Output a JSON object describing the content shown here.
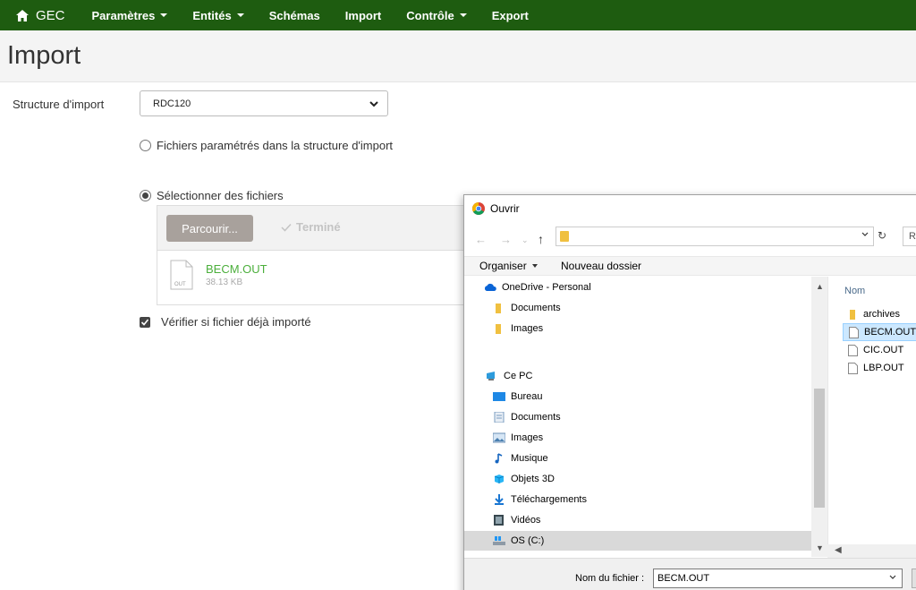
{
  "navbar": {
    "brand": "GEC",
    "items": [
      {
        "label": "Paramètres",
        "dropdown": true
      },
      {
        "label": "Entités",
        "dropdown": true
      },
      {
        "label": "Schémas",
        "dropdown": false
      },
      {
        "label": "Import",
        "dropdown": false
      },
      {
        "label": "Contrôle",
        "dropdown": true
      },
      {
        "label": "Export",
        "dropdown": false
      }
    ],
    "bg_color": "#1e5c10"
  },
  "page": {
    "title": "Import"
  },
  "form": {
    "structure_label": "Structure d'import",
    "structure_value": "RDC120",
    "radio_param": "Fichiers paramétrés dans la structure d'import",
    "radio_select": "Sélectionner des fichiers",
    "browse_label": "Parcourir...",
    "done_label": "Terminé",
    "file": {
      "name": "BECM.OUT",
      "size": "38.13 KB",
      "icon_text": "OUT"
    },
    "check_label": "Vérifier si fichier déjà importé"
  },
  "dialog": {
    "title": "Ouvrir",
    "toolbar": {
      "organise": "Organiser",
      "new_folder": "Nouveau dossier"
    },
    "search_placeholder": "R",
    "nav_items": [
      {
        "label": "OneDrive - Personal",
        "icon": "cloud-icon",
        "indent": 1
      },
      {
        "label": "Documents",
        "icon": "folder-icon",
        "indent": 2
      },
      {
        "label": "Images",
        "icon": "folder-icon",
        "indent": 2
      },
      {
        "label": "Ce PC",
        "icon": "computer-icon",
        "indent": 1
      },
      {
        "label": "Bureau",
        "icon": "desktop-icon",
        "indent": 2
      },
      {
        "label": "Documents",
        "icon": "documents-icon",
        "indent": 2
      },
      {
        "label": "Images",
        "icon": "images-icon",
        "indent": 2
      },
      {
        "label": "Musique",
        "icon": "music-icon",
        "indent": 2
      },
      {
        "label": "Objets 3D",
        "icon": "cube-icon",
        "indent": 2
      },
      {
        "label": "Téléchargements",
        "icon": "download-icon",
        "indent": 2
      },
      {
        "label": "Vidéos",
        "icon": "video-icon",
        "indent": 2
      },
      {
        "label": "OS (C:)",
        "icon": "drive-icon",
        "indent": 2
      }
    ],
    "column_header": "Nom",
    "files": [
      {
        "label": "archives",
        "type": "folder"
      },
      {
        "label": "BECM.OUT",
        "type": "file"
      },
      {
        "label": "CIC.OUT",
        "type": "file"
      },
      {
        "label": "LBP.OUT",
        "type": "file"
      }
    ],
    "filename_label": "Nom du fichier :",
    "filename_value": "BECM.OUT"
  }
}
